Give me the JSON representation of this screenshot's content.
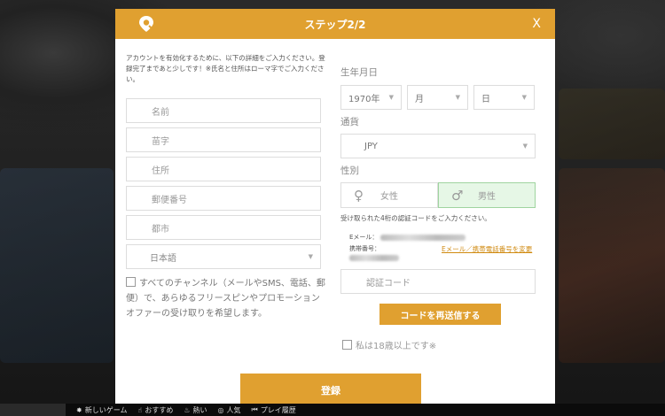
{
  "modal": {
    "title": "ステップ2/2",
    "close_label": "X",
    "intro": "アカウントを有効化するために、以下の詳細をご入力ください。登録完了まであと少しです！※氏名と住所はローマ字でご入力ください。",
    "fields": {
      "first_name": "名前",
      "last_name": "苗字",
      "address": "住所",
      "postal_code": "郵便番号",
      "city": "都市",
      "language": "日本語"
    },
    "consent": "すべてのチャンネル（メールやSMS、電話、郵便）で、あらゆるフリースピンやプロモーションオファーの受け取りを希望します。",
    "dob": {
      "label": "生年月日",
      "year": "1970年",
      "month": "月",
      "day": "日"
    },
    "currency": {
      "label": "通貨",
      "value": "JPY"
    },
    "gender": {
      "label": "性別",
      "female": "女性",
      "male": "男性"
    },
    "code_note": "受け取られた4桁の認証コードをご入力ください。",
    "email_label": "Eメール：",
    "phone_label": "携帯番号：",
    "change_link": "Eメール／携帯電話番号を変更",
    "code_placeholder": "認証コード",
    "resend_button": "コードを再送信する",
    "age_confirm": "私は18歳以上です※",
    "register_button": "登録"
  },
  "bottom_nav": {
    "items": [
      "新しいゲーム",
      "おすすめ",
      "熱い",
      "人気",
      "プレイ履歴"
    ]
  },
  "colors": {
    "accent": "#e0a030",
    "selected_bg": "#e6f7e6"
  }
}
